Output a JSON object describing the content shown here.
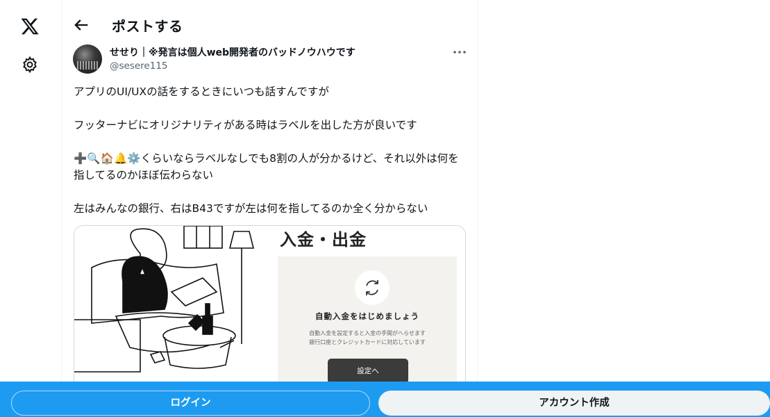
{
  "header": {
    "title": "ポストする"
  },
  "post": {
    "display_name": "せせり｜※発言は個人web開発者のバッドノウハウです",
    "handle": "@sesere115",
    "paragraphs": [
      "アプリのUI/UXの話をするときにいつも話すんですが",
      "フッターナビにオリジナリティがある時はラベルを出した方が良いです",
      "くらいならラベルなしでも8割の人が分かるけど、それ以外は何を指してるのかほぼ伝わらない",
      "左はみんなの銀行、右はB43ですが左は何を指してるのか全く分からない"
    ],
    "emojis": [
      "➕",
      "🔍",
      "🏠",
      "🔔",
      "⚙️"
    ]
  },
  "media": {
    "title": "入金・出金",
    "heading": "自動入金をはじめましょう",
    "desc_line1": "自動入金を設定すると入金の手間がへらせます",
    "desc_line2": "銀行口座とクレジットカードに対応しています",
    "button": "設定へ"
  },
  "bottom_bar": {
    "login": "ログイン",
    "signup": "アカウント作成"
  },
  "icons": {
    "logo": "x-logo",
    "settings": "gear-icon",
    "back": "arrow-left-icon",
    "more": "more-horizontal-icon",
    "refresh": "refresh-icon"
  },
  "colors": {
    "accent": "#1d9bf0",
    "text": "#0f1419",
    "muted": "#536471"
  }
}
